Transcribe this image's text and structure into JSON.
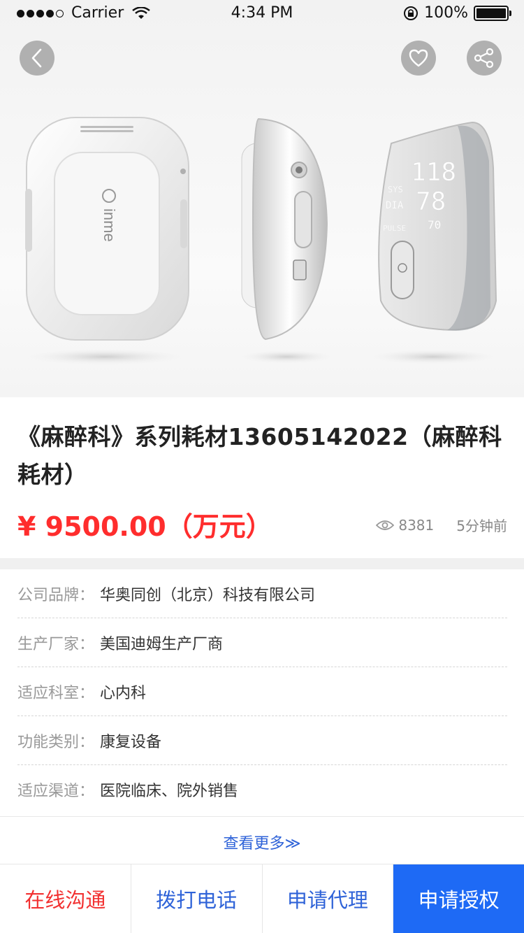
{
  "status_bar": {
    "carrier": "Carrier",
    "time": "4:34 PM",
    "battery": "100%"
  },
  "product_image": {
    "device_logo": "inme",
    "display_sys_label": "SYS",
    "display_sys_value": "118",
    "display_dia_label": "DIA",
    "display_dia_value": "78",
    "display_pulse_label": "PULSE",
    "display_pulse_value": "70"
  },
  "product": {
    "title": "《麻醉科》系列耗材13605142022（麻醉科耗材）",
    "price": "¥ 9500.00（万元）",
    "views": "8381",
    "time_ago": "5分钟前"
  },
  "info": [
    {
      "label": "公司品牌：",
      "value": "华奥同创（北京）科技有限公司"
    },
    {
      "label": "生产厂家：",
      "value": "美国迪姆生产厂商"
    },
    {
      "label": "适应科室：",
      "value": "心内科"
    },
    {
      "label": "功能类别：",
      "value": "康复设备"
    },
    {
      "label": "适应渠道：",
      "value": "医院临床、院外销售"
    }
  ],
  "more_link": "查看更多≫",
  "actions": {
    "chat": "在线沟通",
    "call": "拨打电话",
    "agent": "申请代理",
    "authorize": "申请授权"
  },
  "colors": {
    "price": "#ff2d2d",
    "link": "#2f63d8",
    "primary_button": "#1e6af5",
    "chat_button": "#f23030"
  }
}
